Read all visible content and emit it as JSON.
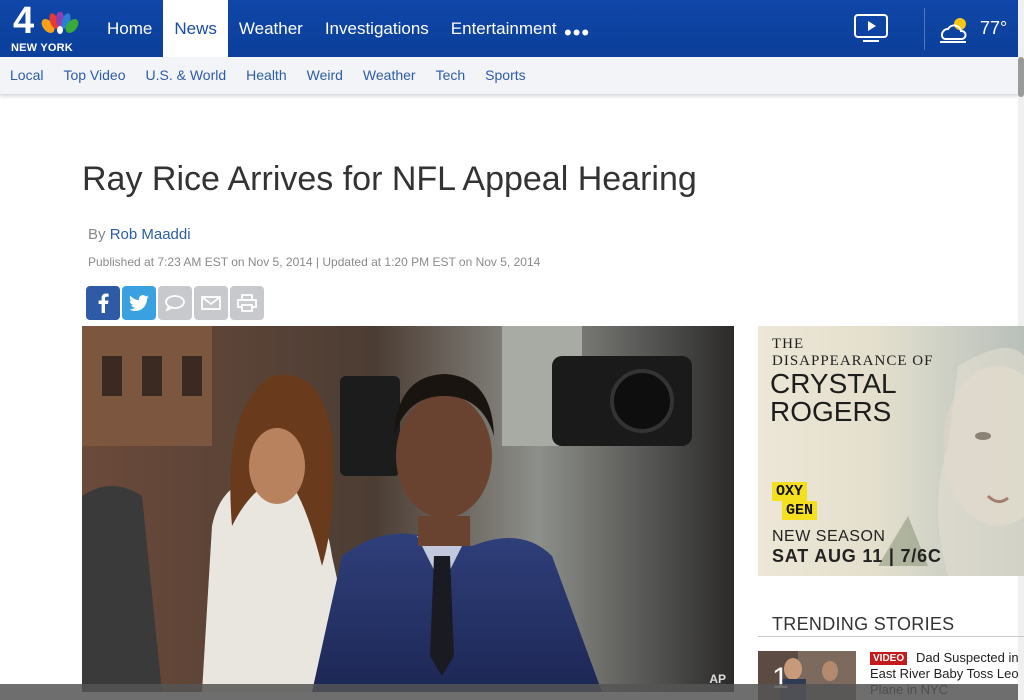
{
  "logo": {
    "number": "4",
    "label": "NEW YORK"
  },
  "nav": {
    "items": [
      {
        "label": "Home"
      },
      {
        "label": "News"
      },
      {
        "label": "Weather"
      },
      {
        "label": "Investigations"
      },
      {
        "label": "Entertainment"
      }
    ],
    "more": "•••",
    "temperature": "77°"
  },
  "subnav": {
    "items": [
      {
        "label": "Local"
      },
      {
        "label": "Top Video"
      },
      {
        "label": "U.S. & World"
      },
      {
        "label": "Health"
      },
      {
        "label": "Weird"
      },
      {
        "label": "Weather"
      },
      {
        "label": "Tech"
      },
      {
        "label": "Sports"
      }
    ]
  },
  "article": {
    "headline": "Ray Rice Arrives for NFL Appeal Hearing",
    "by_prefix": "By",
    "author": "Rob Maaddi",
    "published": "Published at 7:23 AM EST on Nov 5, 2014 | Updated at 1:20 PM EST on Nov 5, 2014",
    "photo_credit": "AP"
  },
  "ad": {
    "line1": "THE",
    "line2": "DISAPPEARANCE OF",
    "line3": "CRYSTAL",
    "line4": "ROGERS",
    "brand1": "OXY",
    "brand2": "GEN",
    "season": "NEW SEASON",
    "date": "SAT AUG 11 | 7/6C"
  },
  "trending": {
    "title": "TRENDING STORIES",
    "items": [
      {
        "number": "1",
        "badge": "VIDEO",
        "text": "Dad Suspected in East River Baby Toss Leo Plane in NYC"
      }
    ]
  },
  "colors": {
    "brand_blue": "#1046a8",
    "link_blue": "#2d5ca8",
    "facebook": "#2e5aa6",
    "twitter": "#3aa0e0",
    "video_red": "#c41a1a"
  }
}
